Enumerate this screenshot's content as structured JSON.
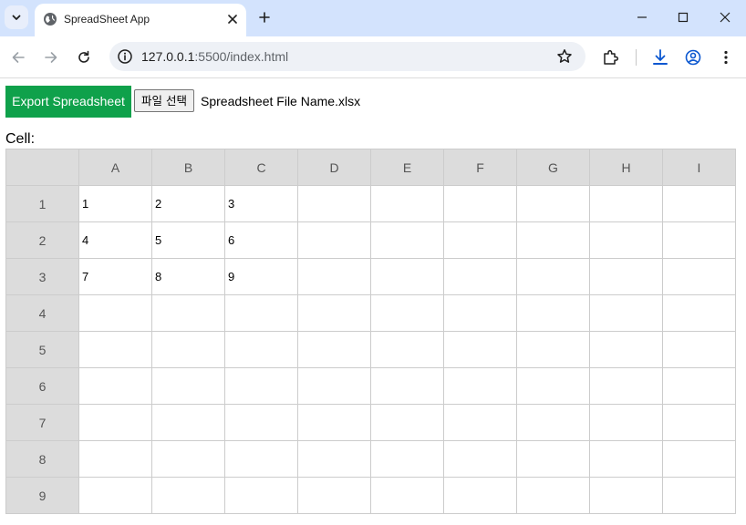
{
  "browser": {
    "tab_title": "SpreadSheet App",
    "url_host": "127.0.0.1",
    "url_rest": ":5500/index.html"
  },
  "page": {
    "export_label": "Export Spreadsheet",
    "file_button_label": "파일 선택",
    "file_name": "Spreadsheet File Name.xlsx",
    "cell_label": "Cell:"
  },
  "sheet": {
    "columns": [
      "A",
      "B",
      "C",
      "D",
      "E",
      "F",
      "G",
      "H",
      "I"
    ],
    "rows": [
      {
        "label": "1",
        "cells": [
          "1",
          "2",
          "3",
          "",
          "",
          "",
          "",
          "",
          ""
        ]
      },
      {
        "label": "2",
        "cells": [
          "4",
          "5",
          "6",
          "",
          "",
          "",
          "",
          "",
          ""
        ]
      },
      {
        "label": "3",
        "cells": [
          "7",
          "8",
          "9",
          "",
          "",
          "",
          "",
          "",
          ""
        ]
      },
      {
        "label": "4",
        "cells": [
          "",
          "",
          "",
          "",
          "",
          "",
          "",
          "",
          ""
        ]
      },
      {
        "label": "5",
        "cells": [
          "",
          "",
          "",
          "",
          "",
          "",
          "",
          "",
          ""
        ]
      },
      {
        "label": "6",
        "cells": [
          "",
          "",
          "",
          "",
          "",
          "",
          "",
          "",
          ""
        ]
      },
      {
        "label": "7",
        "cells": [
          "",
          "",
          "",
          "",
          "",
          "",
          "",
          "",
          ""
        ]
      },
      {
        "label": "8",
        "cells": [
          "",
          "",
          "",
          "",
          "",
          "",
          "",
          "",
          ""
        ]
      },
      {
        "label": "9",
        "cells": [
          "",
          "",
          "",
          "",
          "",
          "",
          "",
          "",
          ""
        ]
      }
    ]
  },
  "colors": {
    "export_button": "#0fa14b",
    "header_fill": "#dcdcdc",
    "titlebar": "#d3e3fd",
    "download_accent": "#0b57d0"
  },
  "icons": {
    "tab_search": "chevron-down-icon",
    "favicon": "globe-icon",
    "tab_close": "close-icon",
    "new_tab": "plus-icon",
    "minimize": "minimize-icon",
    "maximize": "maximize-icon",
    "close_window": "close-icon",
    "back": "arrow-left-icon",
    "forward": "arrow-right-icon",
    "reload": "reload-icon",
    "site_info": "info-icon",
    "bookmark": "star-icon",
    "extensions": "puzzle-icon",
    "downloads": "download-icon",
    "profile": "profile-icon",
    "menu": "kebab-menu-icon"
  }
}
